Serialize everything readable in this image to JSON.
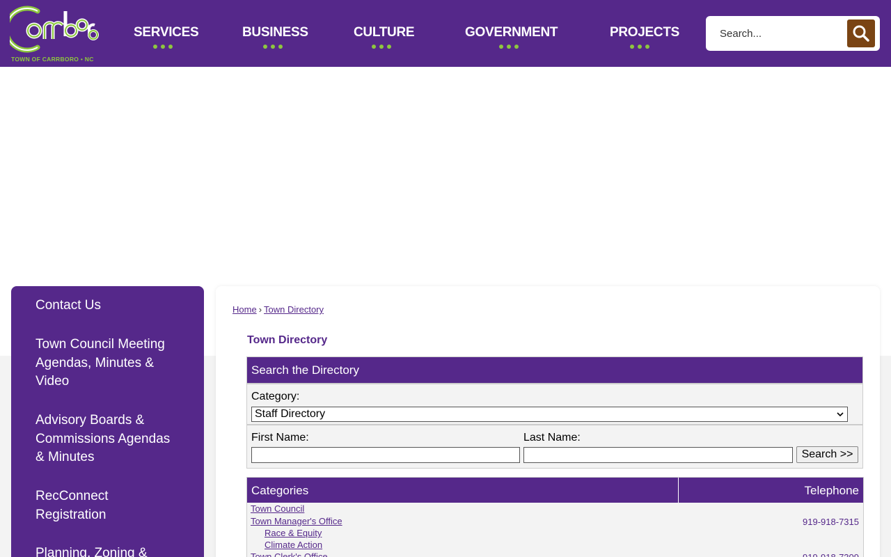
{
  "header": {
    "logo_text": "Carrboro",
    "logo_caption": "TOWN OF CARRBORO • NC",
    "nav": [
      {
        "label": "SERVICES"
      },
      {
        "label": "BUSINESS"
      },
      {
        "label": "CULTURE"
      },
      {
        "label": "GOVERNMENT"
      },
      {
        "label": "PROJECTS"
      }
    ],
    "search_placeholder": "Search..."
  },
  "sidebar": {
    "items": [
      {
        "label": "Contact Us"
      },
      {
        "label": "Town Council Meeting Agendas, Minutes & Video"
      },
      {
        "label": "Advisory Boards & Commissions Agendas & Minutes"
      },
      {
        "label": "RecConnect Registration"
      },
      {
        "label": "Planning, Zoning &"
      }
    ]
  },
  "breadcrumb": {
    "home": "Home",
    "separator": "›",
    "current": "Town Directory"
  },
  "page_title": "Town Directory",
  "directory_search": {
    "heading": "Search the Directory",
    "category_label": "Category:",
    "category_selected": "Staff Directory",
    "first_name_label": "First Name:",
    "first_name_value": "",
    "last_name_label": "Last Name:",
    "last_name_value": "",
    "search_button": "Search >>"
  },
  "categories_table": {
    "col_categories": "Categories",
    "col_telephone": "Telephone",
    "rows": [
      {
        "name": "Town Council",
        "phone": ""
      },
      {
        "name": "Town Manager's Office",
        "phone": "919-918-7315"
      },
      {
        "name": "Race & Equity",
        "phone": ""
      },
      {
        "name": "Climate Action",
        "phone": ""
      },
      {
        "name": "Town Clerk's Office",
        "phone": "919-918-7309"
      }
    ]
  },
  "colors": {
    "brand_purple": "#55288a",
    "accent_green": "#8dc63f",
    "search_button": "#7a4413",
    "panel_gray": "#f3f3f3"
  }
}
